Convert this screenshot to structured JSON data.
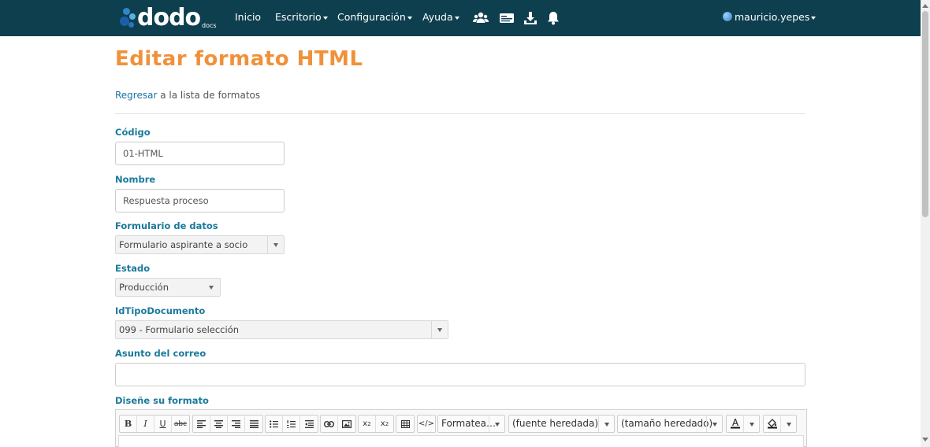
{
  "nav": {
    "logo_text": "dodo",
    "logo_sub": "docs",
    "items": [
      {
        "label": "Inicio"
      },
      {
        "label": "Escritorio"
      },
      {
        "label": "Configuración"
      },
      {
        "label": "Ayuda"
      }
    ],
    "icons": [
      "users-icon",
      "card-icon",
      "download-icon",
      "bell-icon"
    ],
    "user": "mauricio.yepes"
  },
  "page": {
    "title": "Editar formato HTML",
    "back_link": "Regresar",
    "back_text": " a la lista de formatos"
  },
  "form": {
    "codigo_label": "Código",
    "codigo_value": "01-HTML",
    "nombre_label": "Nombre",
    "nombre_value": "Respuesta proceso",
    "formulario_label": "Formulario de datos",
    "formulario_value": "Formulario aspirante a socio",
    "estado_label": "Estado",
    "estado_value": "Producción",
    "tipo_label": "IdTipoDocumento",
    "tipo_value": "099 - Formulario selección",
    "asunto_label": "Asunto del correo",
    "asunto_value": "",
    "disenio_label": "Diseñe su formato"
  },
  "toolbar": {
    "format_label": "Formatea…",
    "font_label": "(fuente heredada)",
    "size_label": "(tamaño heredado)"
  },
  "colors": {
    "navbar": "#0e3f4f",
    "title": "#f0913a",
    "label": "#1a7a9c",
    "link": "#1a73a8"
  }
}
